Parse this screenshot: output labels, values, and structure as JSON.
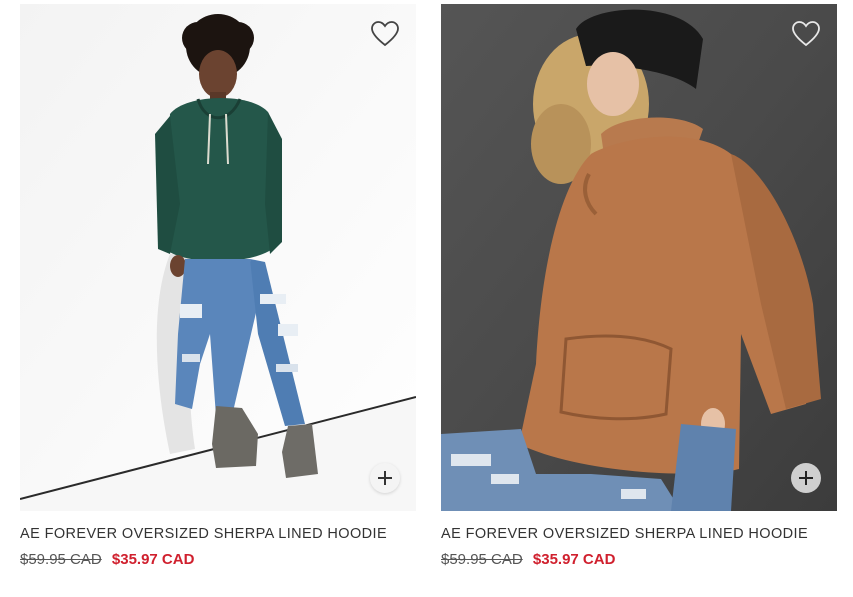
{
  "products": [
    {
      "name": "AE FOREVER OVERSIZED SHERPA LINED HOODIE",
      "original_price": "$59.95 CAD",
      "sale_price": "$35.97 CAD",
      "image": "green-hoodie-model",
      "favorite_icon": "heart-outline-icon",
      "add_icon": "plus-icon"
    },
    {
      "name": "AE FOREVER OVERSIZED SHERPA LINED HOODIE",
      "original_price": "$59.95 CAD",
      "sale_price": "$35.97 CAD",
      "image": "tan-hoodie-model",
      "favorite_icon": "heart-outline-icon",
      "add_icon": "plus-icon"
    }
  ],
  "colors": {
    "sale": "#d0202e",
    "text": "#333333"
  }
}
